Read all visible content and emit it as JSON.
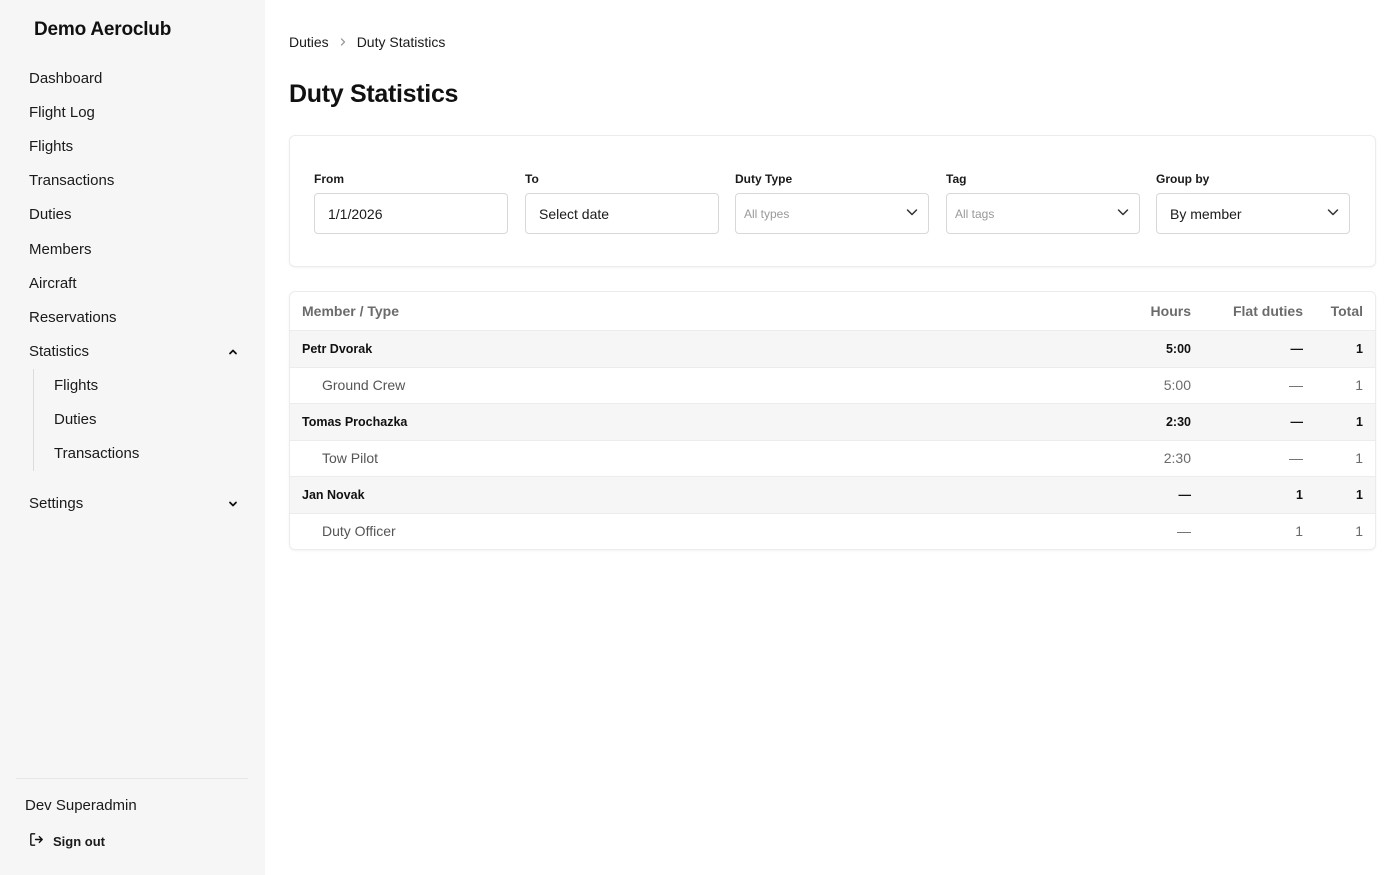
{
  "sidebar": {
    "brand": "Demo Aeroclub",
    "items": [
      {
        "label": "Dashboard"
      },
      {
        "label": "Flight Log"
      },
      {
        "label": "Flights"
      },
      {
        "label": "Transactions"
      },
      {
        "label": "Duties"
      },
      {
        "label": "Members"
      },
      {
        "label": "Aircraft"
      },
      {
        "label": "Reservations"
      },
      {
        "label": "Statistics",
        "expanded": true
      }
    ],
    "statistics_children": [
      {
        "label": "Flights"
      },
      {
        "label": "Duties"
      },
      {
        "label": "Transactions"
      }
    ],
    "settings": {
      "label": "Settings",
      "expanded": false
    },
    "user": {
      "name": "Dev Superadmin"
    },
    "signout_label": "Sign out"
  },
  "breadcrumb": {
    "parent": "Duties",
    "current": "Duty Statistics"
  },
  "page_title": "Duty Statistics",
  "filters": {
    "from": {
      "label": "From",
      "value": "1/1/2026"
    },
    "to": {
      "label": "To",
      "value": "Select date"
    },
    "duty_type": {
      "label": "Duty Type",
      "placeholder": "All types"
    },
    "tag": {
      "label": "Tag",
      "placeholder": "All tags"
    },
    "group_by": {
      "label": "Group by",
      "value": "By member"
    }
  },
  "table": {
    "headers": {
      "member": "Member / Type",
      "hours": "Hours",
      "flat": "Flat duties",
      "total": "Total"
    },
    "groups": [
      {
        "member": "Petr Dvorak",
        "hours": "5:00",
        "flat": "—",
        "total": "1",
        "details": [
          {
            "type": "Ground Crew",
            "hours": "5:00",
            "flat": "—",
            "total": "1"
          }
        ]
      },
      {
        "member": "Tomas Prochazka",
        "hours": "2:30",
        "flat": "—",
        "total": "1",
        "details": [
          {
            "type": "Tow Pilot",
            "hours": "2:30",
            "flat": "—",
            "total": "1"
          }
        ]
      },
      {
        "member": "Jan Novak",
        "hours": "—",
        "flat": "1",
        "total": "1",
        "details": [
          {
            "type": "Duty Officer",
            "hours": "—",
            "flat": "1",
            "total": "1"
          }
        ]
      }
    ]
  }
}
